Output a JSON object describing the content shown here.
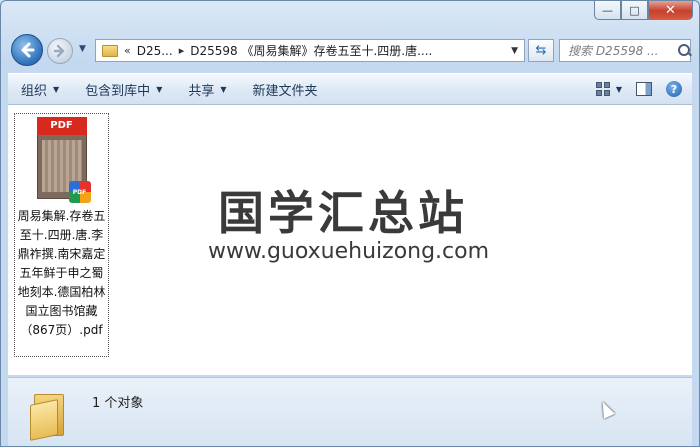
{
  "window": {
    "caption": {
      "minimize": "—",
      "maximize": "□",
      "close": "✕"
    }
  },
  "nav": {
    "breadcrumb_overflow": "«",
    "crumb_root": "D25...",
    "crumb_path": "D25598 《周易集解》存卷五至十.四册.唐....",
    "search_placeholder": "搜索 D25598 ..."
  },
  "toolbar": {
    "organize": "组织",
    "include_library": "包含到库中",
    "share": "共享",
    "new_folder": "新建文件夹"
  },
  "content": {
    "file": {
      "thumb_label": "PDF",
      "badge": "PDF",
      "name": "周易集解.存卷五至十.四册.唐.李鼎祚撰.南宋嘉定五年鲜于申之蜀地刻本.德国柏林国立图书馆藏（867页）.pdf"
    },
    "watermark_title": "国学汇总站",
    "watermark_url": "www.guoxuehuizong.com"
  },
  "status": {
    "count_text": "1 个对象"
  }
}
